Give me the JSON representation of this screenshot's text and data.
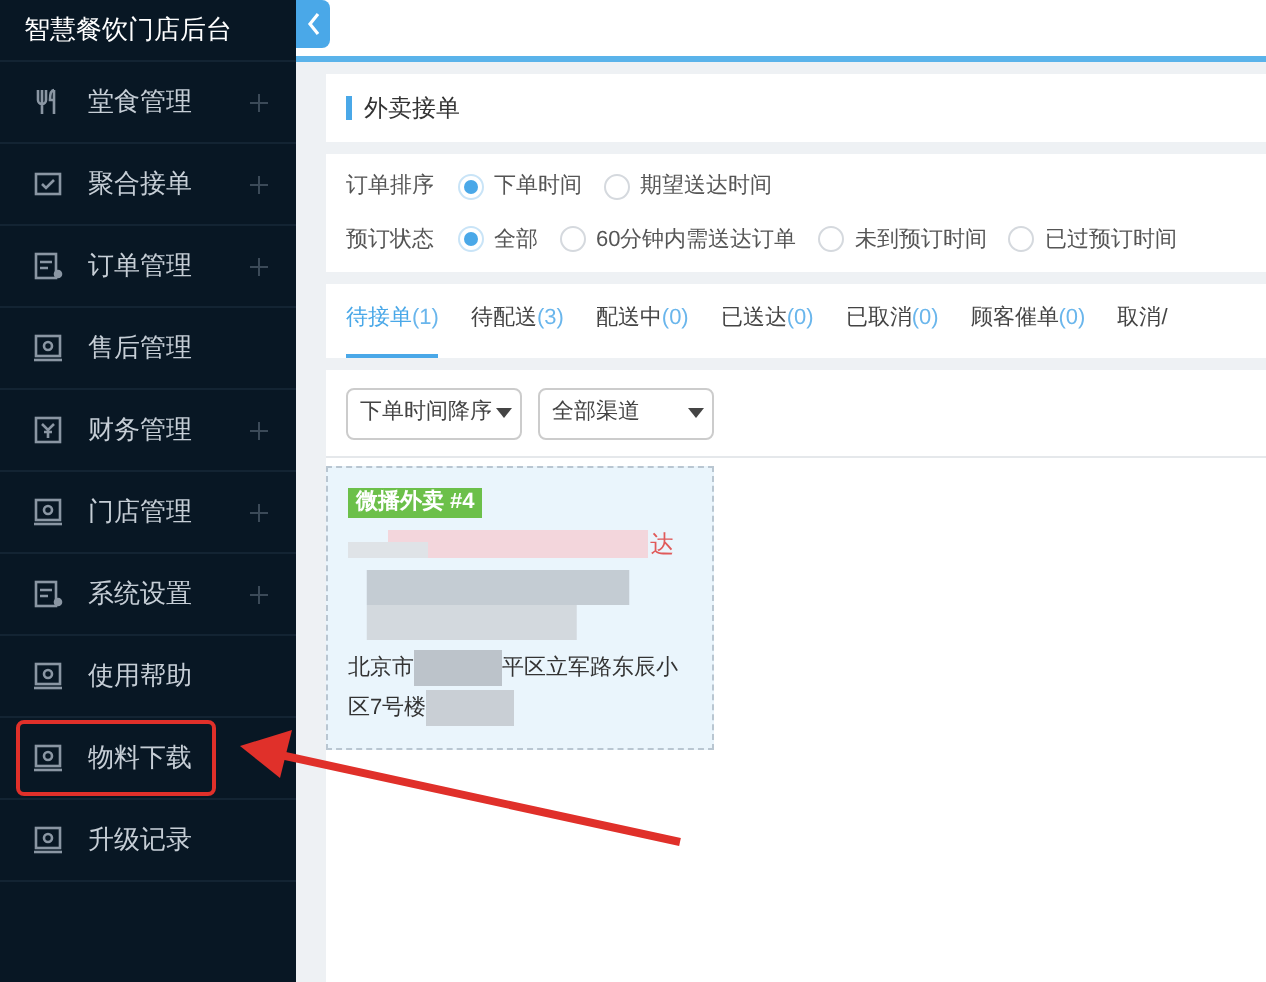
{
  "sidebar": {
    "title": "智慧餐饮门店后台",
    "items": [
      {
        "label": "堂食管理",
        "kind": "utensils",
        "expandable": true,
        "annotated": false
      },
      {
        "label": "聚合接单",
        "kind": "check",
        "expandable": true,
        "annotated": false
      },
      {
        "label": "订单管理",
        "kind": "doc",
        "expandable": true,
        "annotated": false
      },
      {
        "label": "售后管理",
        "kind": "monitor",
        "expandable": false,
        "annotated": false
      },
      {
        "label": "财务管理",
        "kind": "yen",
        "expandable": true,
        "annotated": false
      },
      {
        "label": "门店管理",
        "kind": "monitor",
        "expandable": true,
        "annotated": false
      },
      {
        "label": "系统设置",
        "kind": "doc",
        "expandable": true,
        "annotated": false
      },
      {
        "label": "使用帮助",
        "kind": "monitor",
        "expandable": false,
        "annotated": false
      },
      {
        "label": "物料下载",
        "kind": "monitor",
        "expandable": false,
        "annotated": true
      },
      {
        "label": "升级记录",
        "kind": "monitor",
        "expandable": false,
        "annotated": false
      }
    ]
  },
  "page_title": "外卖接单",
  "filters": [
    {
      "label": "订单排序",
      "options": [
        {
          "label": "下单时间",
          "selected": true
        },
        {
          "label": "期望送达时间",
          "selected": false
        }
      ]
    },
    {
      "label": "预订状态",
      "options": [
        {
          "label": "全部",
          "selected": true
        },
        {
          "label": "60分钟内需送达订单",
          "selected": false
        },
        {
          "label": "未到预订时间",
          "selected": false
        },
        {
          "label": "已过预订时间",
          "selected": false
        }
      ]
    }
  ],
  "tabs": [
    {
      "label": "待接单",
      "count": "(1)",
      "selected": true
    },
    {
      "label": "待配送",
      "count": "(3)",
      "selected": false
    },
    {
      "label": "配送中",
      "count": "(0)",
      "selected": false
    },
    {
      "label": "已送达",
      "count": "(0)",
      "selected": false
    },
    {
      "label": "已取消",
      "count": "(0)",
      "selected": false
    },
    {
      "label": "顾客催单",
      "count": "(0)",
      "selected": false
    },
    {
      "label": "取消/",
      "selected": false
    }
  ],
  "selects": [
    {
      "value": "下单时间降序"
    },
    {
      "value": "全部渠道"
    }
  ],
  "order_card": {
    "tag": "微播外卖 #4",
    "status": "达",
    "address_start": "北京市",
    "address_end": "平区立军路东辰小",
    "address_line2": "区7号楼"
  }
}
